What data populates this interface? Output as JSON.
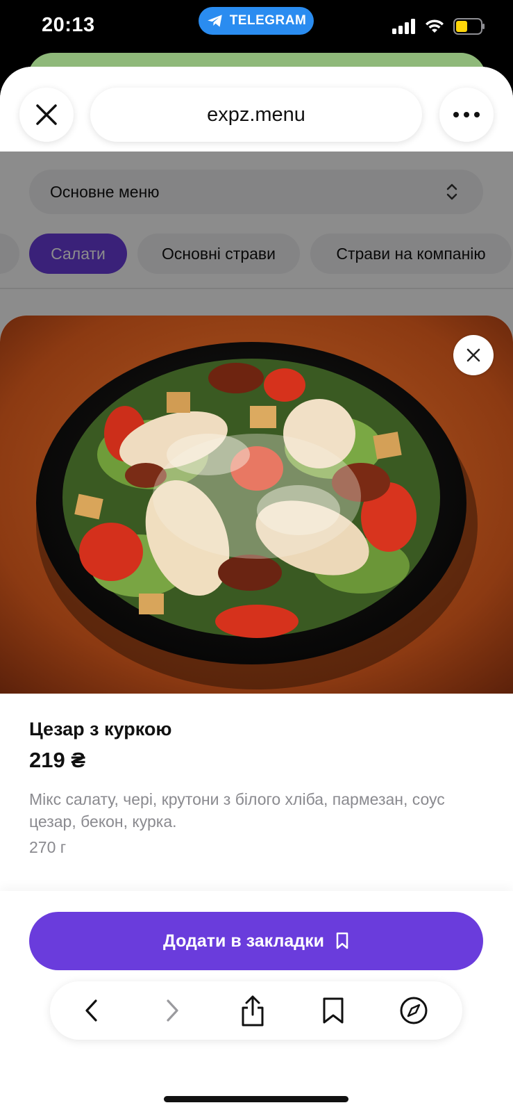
{
  "status_bar": {
    "time": "20:13",
    "return_app": "TELEGRAM",
    "icons": [
      "signal-icon",
      "wifi-icon",
      "battery-icon"
    ]
  },
  "browser": {
    "url": "expz.menu",
    "close_icon": "close-icon",
    "more_icon": "more-icon"
  },
  "page": {
    "menu_select_value": "Основне меню",
    "categories": [
      {
        "label": "",
        "active": false
      },
      {
        "label": "Салати",
        "active": true
      },
      {
        "label": "Основні страви",
        "active": false
      },
      {
        "label": "Страви на компанію",
        "active": false
      }
    ]
  },
  "dish": {
    "name": "Цезар з куркою",
    "price": "219 ₴",
    "description": "Мікс салату, черi, крутони з білого хліба, пармезан, соус цезар, бекон, курка.",
    "weight": "270 г"
  },
  "actions": {
    "bookmark_label": "Додати в закладки"
  },
  "toolbar": {
    "icons": [
      "back-icon",
      "forward-icon",
      "share-icon",
      "bookmarks-icon",
      "compass-icon"
    ]
  },
  "colors": {
    "accent": "#6a3cdc",
    "telegram": "#2a8cf0",
    "battery": "#ffd60a"
  }
}
